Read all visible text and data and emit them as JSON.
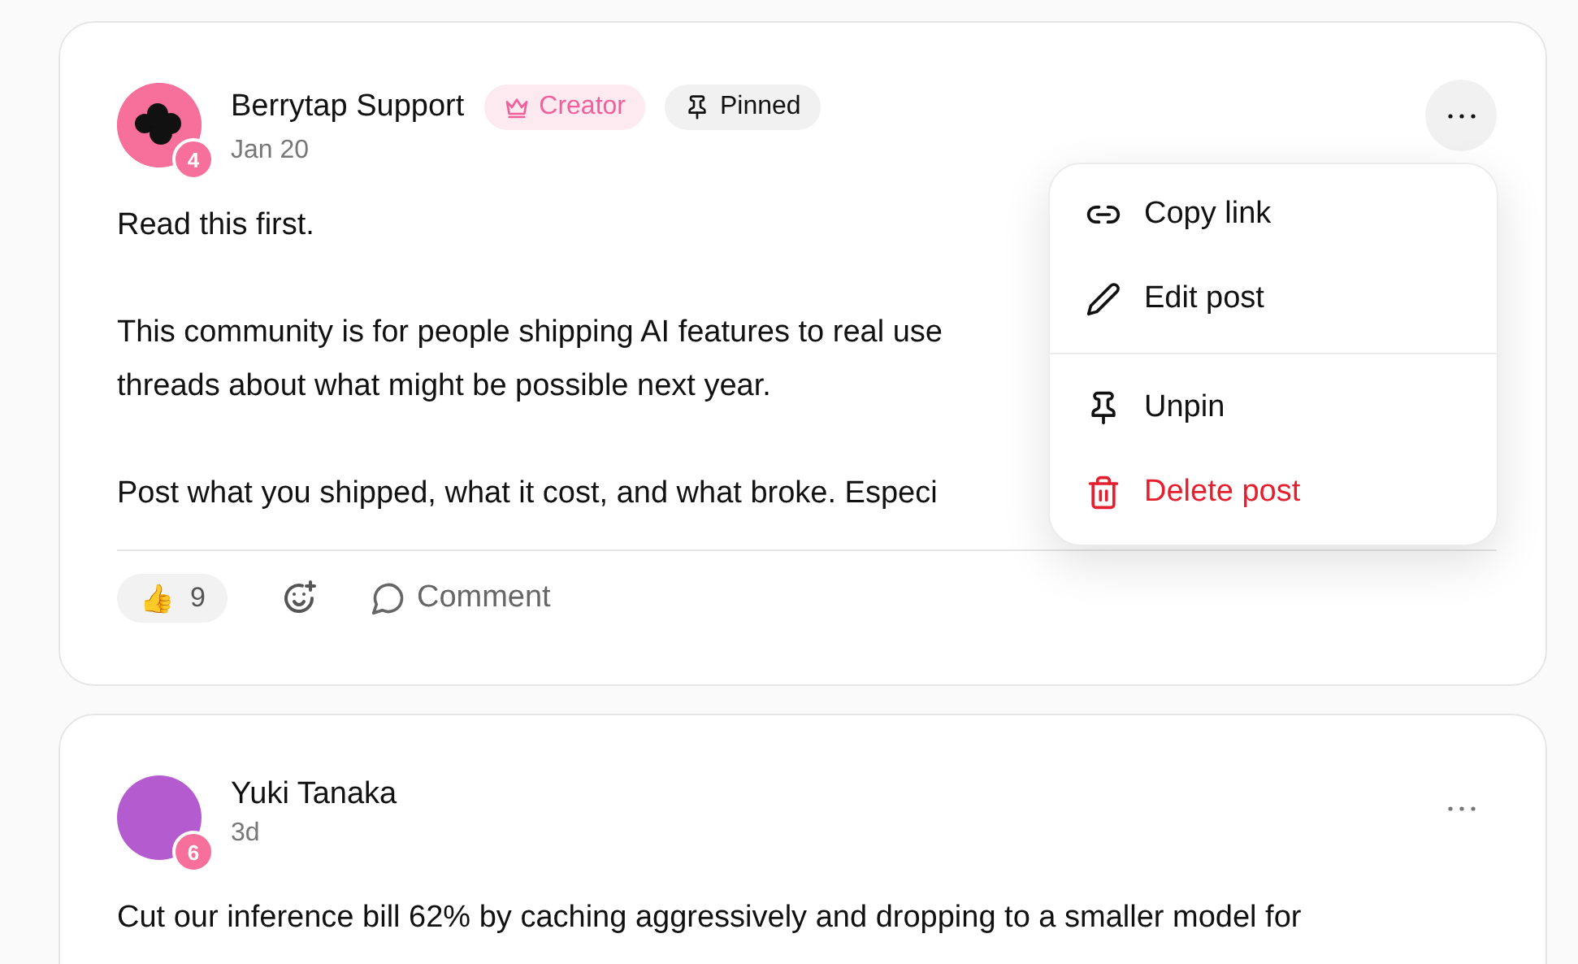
{
  "posts": [
    {
      "author": "Berrytap Support",
      "avatar": {
        "kind": "logo"
      },
      "level": "4",
      "badges": [
        {
          "kind": "creator",
          "label": "Creator"
        },
        {
          "kind": "pinned",
          "label": "Pinned"
        }
      ],
      "date": "Jan 20",
      "menu_open": true,
      "paragraphs": [
        [
          "Read this first."
        ],
        [
          "This community is for people shipping AI features to real use",
          "threads about what might be possible next year."
        ],
        [
          "Post what you shipped, what it cost, and what broke. Especi"
        ]
      ],
      "reactions": [
        {
          "emoji": "👍",
          "count": "9"
        }
      ],
      "comment_label": "Comment",
      "menu": [
        {
          "kind": "link",
          "label": "Copy link",
          "divider_before": false
        },
        {
          "kind": "edit",
          "label": "Edit post",
          "divider_before": false
        },
        {
          "kind": "unpin",
          "label": "Unpin",
          "divider_before": true
        },
        {
          "kind": "delete",
          "label": "Delete post",
          "divider_before": false
        }
      ]
    },
    {
      "author": "Yuki Tanaka",
      "avatar": {
        "kind": "photo"
      },
      "level": "6",
      "date": "3d",
      "menu_open": false,
      "paragraphs": [
        [
          "Cut our inference bill 62% by caching aggressively and dropping to a smaller model for"
        ]
      ]
    }
  ]
}
